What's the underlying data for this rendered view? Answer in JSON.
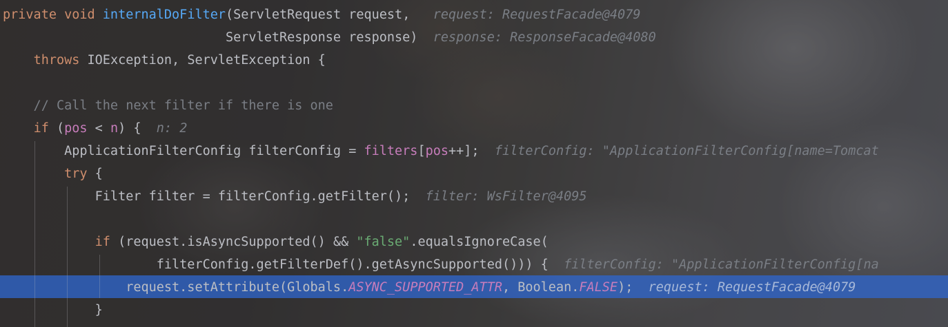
{
  "editor": {
    "lines": [
      [
        {
          "t": "private void ",
          "c": "kw"
        },
        {
          "t": "internalDoFilter",
          "c": "fn"
        },
        {
          "t": "(ServletRequest request,",
          "c": "plain"
        },
        {
          "t": "   request: RequestFacade@4079",
          "c": "hint"
        }
      ],
      [
        {
          "t": "                             ServletResponse response)",
          "c": "plain"
        },
        {
          "t": "  response: ResponseFacade@4080",
          "c": "hint"
        }
      ],
      [
        {
          "t": "    ",
          "c": "plain"
        },
        {
          "t": "throws ",
          "c": "kw"
        },
        {
          "t": "IOException, ServletException {",
          "c": "plain"
        }
      ],
      [],
      [
        {
          "t": "    // Call the next filter if there is one",
          "c": "cm"
        }
      ],
      [
        {
          "t": "    ",
          "c": "plain"
        },
        {
          "t": "if ",
          "c": "kw"
        },
        {
          "t": "(",
          "c": "plain"
        },
        {
          "t": "pos",
          "c": "field"
        },
        {
          "t": " < ",
          "c": "plain"
        },
        {
          "t": "n",
          "c": "field"
        },
        {
          "t": ") {",
          "c": "plain"
        },
        {
          "t": "  n: 2",
          "c": "hint"
        }
      ],
      [
        {
          "t": "        ApplicationFilterConfig filterConfig = ",
          "c": "plain"
        },
        {
          "t": "filters",
          "c": "field"
        },
        {
          "t": "[",
          "c": "plain"
        },
        {
          "t": "pos",
          "c": "field"
        },
        {
          "t": "++];",
          "c": "plain"
        },
        {
          "t": "  filterConfig: \"ApplicationFilterConfig[name=Tomcat",
          "c": "hint"
        }
      ],
      [
        {
          "t": "        ",
          "c": "plain"
        },
        {
          "t": "try",
          "c": "kw"
        },
        {
          "t": " {",
          "c": "plain"
        }
      ],
      [
        {
          "t": "            Filter filter = filterConfig.getFilter();",
          "c": "plain"
        },
        {
          "t": "  filter: WsFilter@4095",
          "c": "hint"
        }
      ],
      [],
      [
        {
          "t": "            ",
          "c": "plain"
        },
        {
          "t": "if",
          "c": "kw"
        },
        {
          "t": " (request.isAsyncSupported() && ",
          "c": "plain"
        },
        {
          "t": "\"false\"",
          "c": "str"
        },
        {
          "t": ".equalsIgnoreCase(",
          "c": "plain"
        }
      ],
      [
        {
          "t": "                    filterConfig.getFilterDef().getAsyncSupported())) {",
          "c": "plain"
        },
        {
          "t": "  filterConfig: \"ApplicationFilterConfig[na",
          "c": "hint"
        }
      ],
      [
        {
          "t": "                request.setAttribute(Globals.",
          "c": "plain"
        },
        {
          "t": "ASYNC_SUPPORTED_ATTR",
          "c": "const"
        },
        {
          "t": ", Boolean.",
          "c": "plain"
        },
        {
          "t": "FALSE",
          "c": "const"
        },
        {
          "t": ");",
          "c": "plain"
        },
        {
          "t": "  request: RequestFacade@4079",
          "c": "hint-hl"
        }
      ],
      [
        {
          "t": "            }",
          "c": "plain"
        }
      ]
    ],
    "highlighted_line": 12,
    "accent_colors": {
      "keyword": "#cf8e6d",
      "function": "#56a8f5",
      "field": "#c77dbb",
      "string": "#6aab73",
      "comment": "#7a7e85",
      "highlight": "#2f65ca"
    }
  }
}
